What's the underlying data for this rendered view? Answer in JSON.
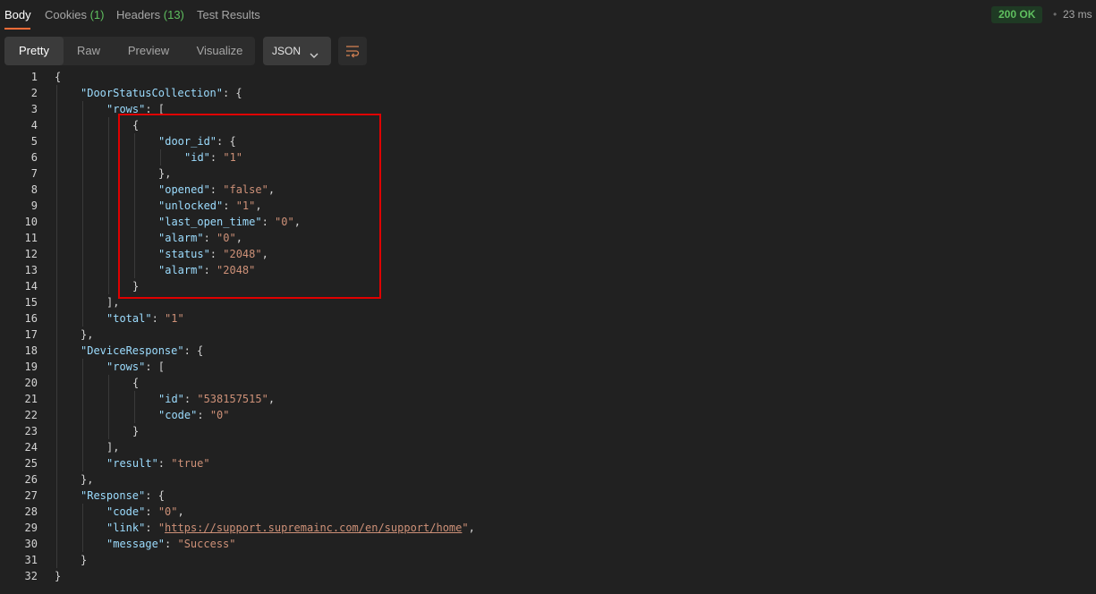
{
  "tabs": {
    "body": "Body",
    "cookies": "Cookies",
    "cookies_count": "(1)",
    "headers": "Headers",
    "headers_count": "(13)",
    "test_results": "Test Results"
  },
  "response_meta": {
    "status": "200 OK",
    "time": "23 ms"
  },
  "toolbar": {
    "modes": [
      "Pretty",
      "Raw",
      "Preview",
      "Visualize"
    ],
    "active_mode": "Pretty",
    "language": "JSON"
  },
  "code_lines": [
    {
      "n": "1",
      "indent": 0,
      "tokens": [
        [
          "p",
          "{"
        ]
      ]
    },
    {
      "n": "2",
      "indent": 1,
      "tokens": [
        [
          "k",
          "\"DoorStatusCollection\""
        ],
        [
          "p",
          ": {"
        ]
      ]
    },
    {
      "n": "3",
      "indent": 2,
      "tokens": [
        [
          "k",
          "\"rows\""
        ],
        [
          "p",
          ": ["
        ]
      ]
    },
    {
      "n": "4",
      "indent": 3,
      "tokens": [
        [
          "p",
          "{"
        ]
      ]
    },
    {
      "n": "5",
      "indent": 4,
      "tokens": [
        [
          "k",
          "\"door_id\""
        ],
        [
          "p",
          ": {"
        ]
      ]
    },
    {
      "n": "6",
      "indent": 5,
      "tokens": [
        [
          "k",
          "\"id\""
        ],
        [
          "p",
          ": "
        ],
        [
          "s",
          "\"1\""
        ]
      ]
    },
    {
      "n": "7",
      "indent": 4,
      "tokens": [
        [
          "p",
          "},"
        ]
      ]
    },
    {
      "n": "8",
      "indent": 4,
      "tokens": [
        [
          "k",
          "\"opened\""
        ],
        [
          "p",
          ": "
        ],
        [
          "s",
          "\"false\""
        ],
        [
          "p",
          ","
        ]
      ]
    },
    {
      "n": "9",
      "indent": 4,
      "tokens": [
        [
          "k",
          "\"unlocked\""
        ],
        [
          "p",
          ": "
        ],
        [
          "s",
          "\"1\""
        ],
        [
          "p",
          ","
        ]
      ]
    },
    {
      "n": "10",
      "indent": 4,
      "tokens": [
        [
          "k",
          "\"last_open_time\""
        ],
        [
          "p",
          ": "
        ],
        [
          "s",
          "\"0\""
        ],
        [
          "p",
          ","
        ]
      ]
    },
    {
      "n": "11",
      "indent": 4,
      "tokens": [
        [
          "k",
          "\"alarm\""
        ],
        [
          "p",
          ": "
        ],
        [
          "s",
          "\"0\""
        ],
        [
          "p",
          ","
        ]
      ]
    },
    {
      "n": "12",
      "indent": 4,
      "tokens": [
        [
          "k",
          "\"status\""
        ],
        [
          "p",
          ": "
        ],
        [
          "s",
          "\"2048\""
        ],
        [
          "p",
          ","
        ]
      ]
    },
    {
      "n": "13",
      "indent": 4,
      "tokens": [
        [
          "k",
          "\"alarm\""
        ],
        [
          "p",
          ": "
        ],
        [
          "s",
          "\"2048\""
        ]
      ]
    },
    {
      "n": "14",
      "indent": 3,
      "tokens": [
        [
          "p",
          "}"
        ]
      ]
    },
    {
      "n": "15",
      "indent": 2,
      "tokens": [
        [
          "p",
          "],"
        ]
      ]
    },
    {
      "n": "16",
      "indent": 2,
      "tokens": [
        [
          "k",
          "\"total\""
        ],
        [
          "p",
          ": "
        ],
        [
          "s",
          "\"1\""
        ]
      ]
    },
    {
      "n": "17",
      "indent": 1,
      "tokens": [
        [
          "p",
          "},"
        ]
      ]
    },
    {
      "n": "18",
      "indent": 1,
      "tokens": [
        [
          "k",
          "\"DeviceResponse\""
        ],
        [
          "p",
          ": {"
        ]
      ]
    },
    {
      "n": "19",
      "indent": 2,
      "tokens": [
        [
          "k",
          "\"rows\""
        ],
        [
          "p",
          ": ["
        ]
      ]
    },
    {
      "n": "20",
      "indent": 3,
      "tokens": [
        [
          "p",
          "{"
        ]
      ]
    },
    {
      "n": "21",
      "indent": 4,
      "tokens": [
        [
          "k",
          "\"id\""
        ],
        [
          "p",
          ": "
        ],
        [
          "s",
          "\"538157515\""
        ],
        [
          "p",
          ","
        ]
      ]
    },
    {
      "n": "22",
      "indent": 4,
      "tokens": [
        [
          "k",
          "\"code\""
        ],
        [
          "p",
          ": "
        ],
        [
          "s",
          "\"0\""
        ]
      ]
    },
    {
      "n": "23",
      "indent": 3,
      "tokens": [
        [
          "p",
          "}"
        ]
      ]
    },
    {
      "n": "24",
      "indent": 2,
      "tokens": [
        [
          "p",
          "],"
        ]
      ]
    },
    {
      "n": "25",
      "indent": 2,
      "tokens": [
        [
          "k",
          "\"result\""
        ],
        [
          "p",
          ": "
        ],
        [
          "s",
          "\"true\""
        ]
      ]
    },
    {
      "n": "26",
      "indent": 1,
      "tokens": [
        [
          "p",
          "},"
        ]
      ]
    },
    {
      "n": "27",
      "indent": 1,
      "tokens": [
        [
          "k",
          "\"Response\""
        ],
        [
          "p",
          ": {"
        ]
      ]
    },
    {
      "n": "28",
      "indent": 2,
      "tokens": [
        [
          "k",
          "\"code\""
        ],
        [
          "p",
          ": "
        ],
        [
          "s",
          "\"0\""
        ],
        [
          "p",
          ","
        ]
      ]
    },
    {
      "n": "29",
      "indent": 2,
      "tokens": [
        [
          "k",
          "\"link\""
        ],
        [
          "p",
          ": "
        ],
        [
          "s",
          "\""
        ],
        [
          "l",
          "https://support.supremainc.com/en/support/home"
        ],
        [
          "s",
          "\""
        ],
        [
          "p",
          ","
        ]
      ]
    },
    {
      "n": "30",
      "indent": 2,
      "tokens": [
        [
          "k",
          "\"message\""
        ],
        [
          "p",
          ": "
        ],
        [
          "s",
          "\"Success\""
        ]
      ]
    },
    {
      "n": "31",
      "indent": 1,
      "tokens": [
        [
          "p",
          "}"
        ]
      ]
    },
    {
      "n": "32",
      "indent": 0,
      "tokens": [
        [
          "p",
          "}"
        ]
      ]
    }
  ],
  "colors": {
    "background": "#212121",
    "key": "#9cdcfe",
    "string": "#ce9178",
    "status_green": "#5fbf5f",
    "highlight": "#e00000"
  },
  "icons": {
    "language_dropdown": "chevron-down-icon",
    "wrap": "wrap-lines-icon"
  }
}
